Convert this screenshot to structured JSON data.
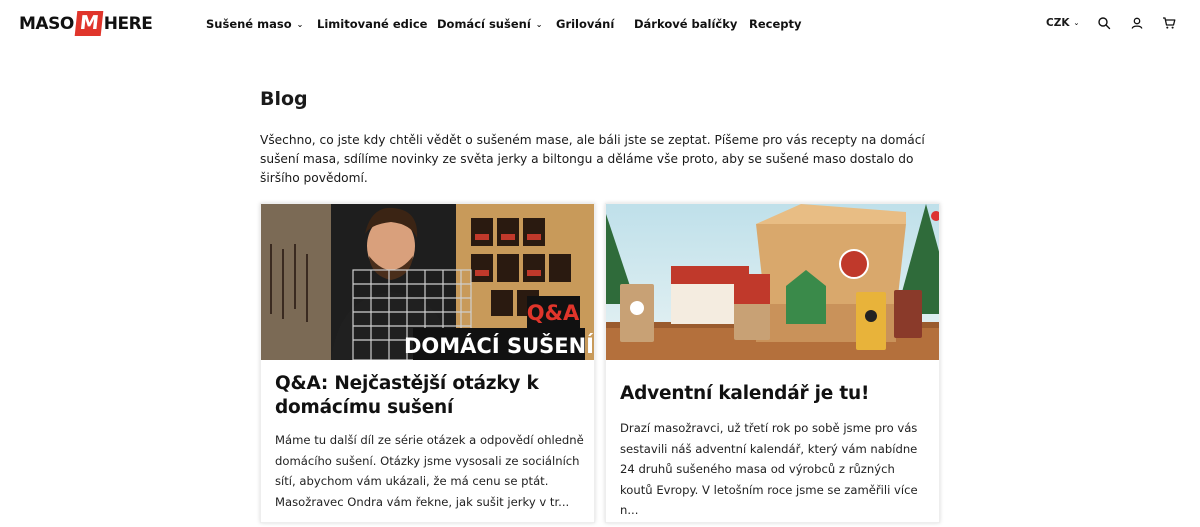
{
  "header": {
    "logo_left": "MASO",
    "logo_badge": "M",
    "logo_right": "HERE",
    "nav": [
      {
        "label": "Sušené maso",
        "has_dropdown": true
      },
      {
        "label": "Limitované edice",
        "has_dropdown": false
      },
      {
        "label": "Domácí sušení",
        "has_dropdown": true
      },
      {
        "label": "Grilování",
        "has_dropdown": false
      },
      {
        "label": "Dárkové balíčky",
        "has_dropdown": false
      },
      {
        "label": "Recepty",
        "has_dropdown": false
      }
    ],
    "currency": "CZK",
    "icons": [
      "search-icon",
      "user-icon",
      "cart-icon"
    ]
  },
  "main": {
    "title": "Blog",
    "intro": "Všechno, co jste kdy chtěli vědět o sušeném mase, ale báli jste se zeptat. Píšeme pro vás recepty na domácí sušení masa, sdílíme novinky ze světa jerky a biltongu a děláme vše proto, aby se sušené maso dostalo do širšího povědomí.",
    "posts": [
      {
        "title": "Q&A: Nejčastější otázky k domácímu sušení",
        "excerpt": "Máme tu další díl ze série otázek a odpovědí ohledně domácího sušení. Otázky jsme vysosali ze sociálních sítí, abychom vám ukázali, že má cenu se ptát. Masožravec Ondra vám řekne, jak sušit jerky v tr...",
        "image_text_qa": "Q&A",
        "image_text_main": "DOMÁCÍ SUŠENÍ"
      },
      {
        "title": "Adventní kalendář je tu!",
        "excerpt": "Drazí masožravci, už třetí rok po sobě jsme pro vás sestavili náš adventní kalendář, který vám nabídne 24 druhů sušeného masa od výrobců z různých koutů Evropy. V letošním roce jsme se zaměřili více n..."
      }
    ]
  },
  "colors": {
    "brand_red": "#e0352b",
    "text": "#1a1a1a"
  }
}
